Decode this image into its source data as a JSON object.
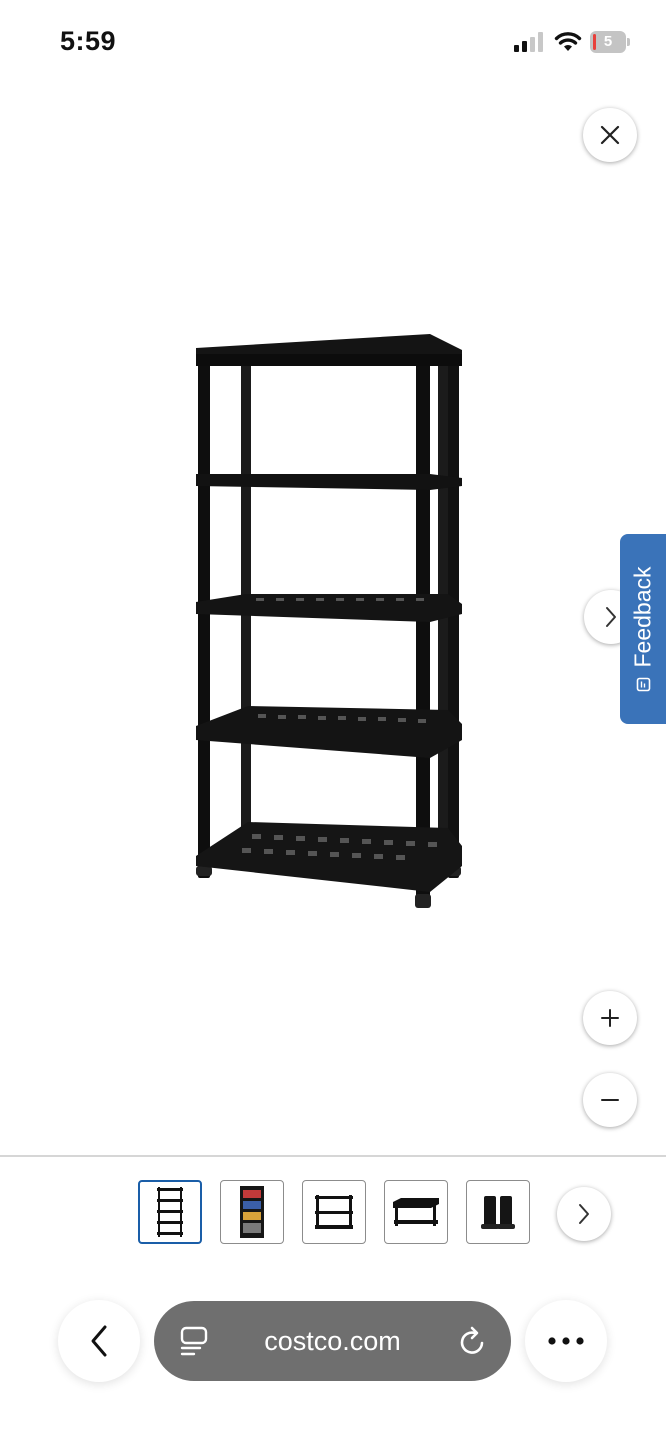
{
  "status_bar": {
    "time": "5:59",
    "battery_level": "5",
    "icons": [
      "cellular-signal-icon",
      "wifi-icon",
      "battery-icon"
    ]
  },
  "viewer": {
    "close_icon": "close-icon",
    "next_icon": "chevron-right-icon",
    "zoom_in_icon": "plus-icon",
    "zoom_out_icon": "minus-icon",
    "main_image": "black 5-tier plastic shelving unit"
  },
  "feedback": {
    "label": "Feedback",
    "color": "#3a73b9"
  },
  "thumbnails": {
    "items": [
      {
        "depicts": "5-tier shelving unit",
        "selected": true
      },
      {
        "depicts": "shelving unit with stored items",
        "selected": false
      },
      {
        "depicts": "short 3-tier shelf",
        "selected": false
      },
      {
        "depicts": "bench-style shelf",
        "selected": false
      },
      {
        "depicts": "shelf leg connectors",
        "selected": false
      }
    ],
    "selected_border_color": "#1a5ea8",
    "next_icon": "chevron-right-icon"
  },
  "browser": {
    "url": "costco.com",
    "back_icon": "chevron-left-icon",
    "reader_icon": "reader-mode-icon",
    "reload_icon": "reload-icon",
    "more_icon": "more-dots-icon",
    "address_bar_color": "#6f6f6f"
  }
}
